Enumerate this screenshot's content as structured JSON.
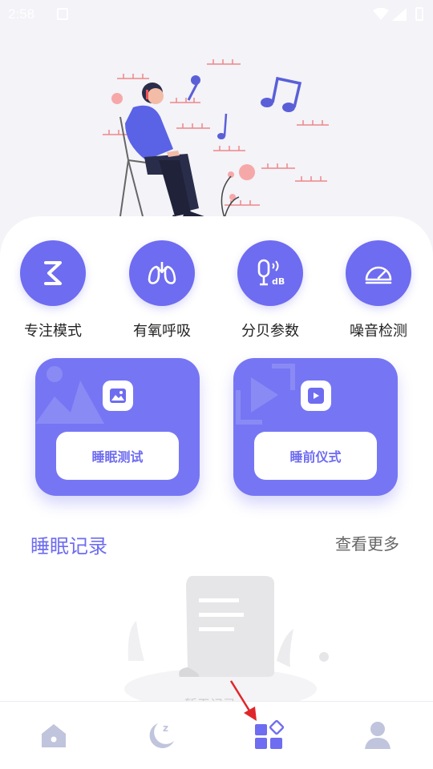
{
  "status_bar": {
    "time": "2:58"
  },
  "tools": [
    {
      "label": "专注模式",
      "icon": "hourglass-icon"
    },
    {
      "label": "有氧呼吸",
      "icon": "lungs-icon"
    },
    {
      "label": "分贝参数",
      "icon": "microphone-db-icon"
    },
    {
      "label": "噪音检测",
      "icon": "gauge-icon"
    }
  ],
  "features": [
    {
      "button_label": "睡眠测试",
      "icon": "image-icon"
    },
    {
      "button_label": "睡前仪式",
      "icon": "video-icon"
    }
  ],
  "records": {
    "title": "睡眠记录",
    "see_more": "查看更多",
    "empty_text": "暂无记录"
  },
  "bottom_nav": [
    {
      "name": "home",
      "icon": "home-icon",
      "active": false
    },
    {
      "name": "sleep",
      "icon": "moon-zz-icon",
      "active": false
    },
    {
      "name": "apps",
      "icon": "apps-grid-icon",
      "active": true
    },
    {
      "name": "profile",
      "icon": "user-icon",
      "active": false
    }
  ],
  "colors": {
    "accent": "#6e6cf0",
    "inactive_nav": "#c0c4dc",
    "background": "#f3f3f8"
  }
}
